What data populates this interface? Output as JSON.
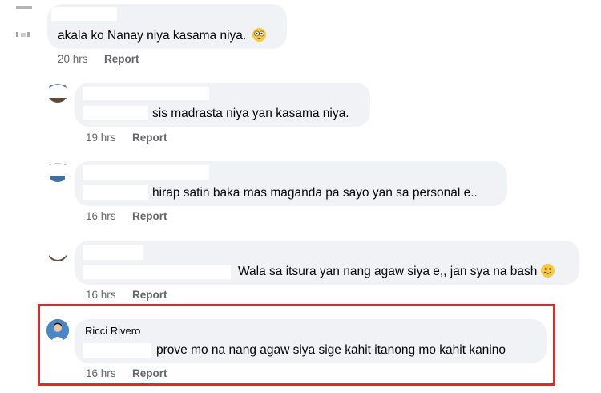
{
  "comments": [
    {
      "text": "akala ko Nanay niya kasama niya.",
      "emoji": "flushed-face-emoji",
      "time": "20 hrs",
      "action": "Report"
    },
    {
      "text": "sis madrasta niya yan kasama niya.",
      "time": "19 hrs",
      "action": "Report"
    },
    {
      "text": "hirap satin baka mas maganda pa sayo yan sa personal e..",
      "time": "16 hrs",
      "action": "Report"
    },
    {
      "text": "Wala sa itsura yan nang agaw siya e,, jan sya na bash",
      "emoji": "smiling-face-emoji",
      "time": "16 hrs",
      "action": "Report"
    },
    {
      "author": "Ricci Rivero",
      "text": "prove mo na nang agaw siya sige kahit itanong mo kahit kanino",
      "time": "16 hrs",
      "action": "Report"
    }
  ],
  "colors": {
    "bubble": "#f0f2f5",
    "meta_text": "#65676b",
    "highlight_border": "#d32f2f"
  }
}
